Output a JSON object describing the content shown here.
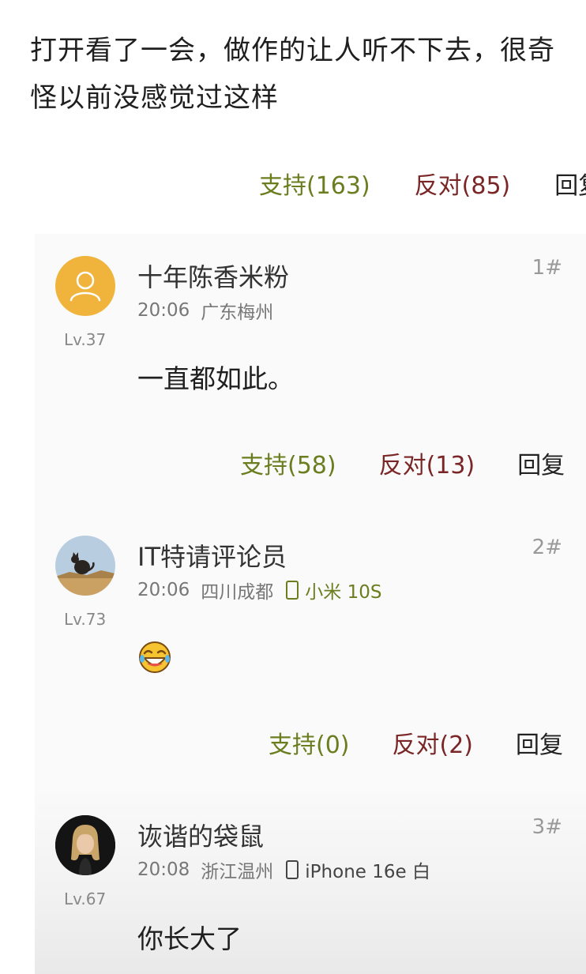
{
  "post": {
    "text": "打开看了一会，做作的让人听不下去，很奇怪以前没感觉过这样",
    "support": "支持(163)",
    "oppose": "反对(85)",
    "reply": "回复"
  },
  "comments": [
    {
      "name": "十年陈香米粉",
      "floor": "1#",
      "time": "20:06",
      "location": "广东梅州",
      "level": "Lv.37",
      "text": "一直都如此。",
      "support": "支持(58)",
      "oppose": "反对(13)",
      "reply": "回复"
    },
    {
      "name": "IT特请评论员",
      "floor": "2#",
      "time": "20:06",
      "location": "四川成都",
      "device": "小米 10S",
      "level": "Lv.73",
      "support": "支持(0)",
      "oppose": "反对(2)",
      "reply": "回复"
    },
    {
      "name": "诙谐的袋鼠",
      "floor": "3#",
      "time": "20:08",
      "location": "浙江温州",
      "device": "iPhone 16e 白",
      "level": "Lv.67",
      "text": "你长大了"
    }
  ],
  "colors": {
    "support": "#6a7d1f",
    "oppose": "#7a2626",
    "device_xiaomi": "#6a7d1f",
    "device_iphone": "#444444"
  },
  "icons": [
    "default-avatar-icon",
    "cat-avatar-icon",
    "photo-avatar-icon",
    "laughing-emoji-icon",
    "phone-icon"
  ]
}
